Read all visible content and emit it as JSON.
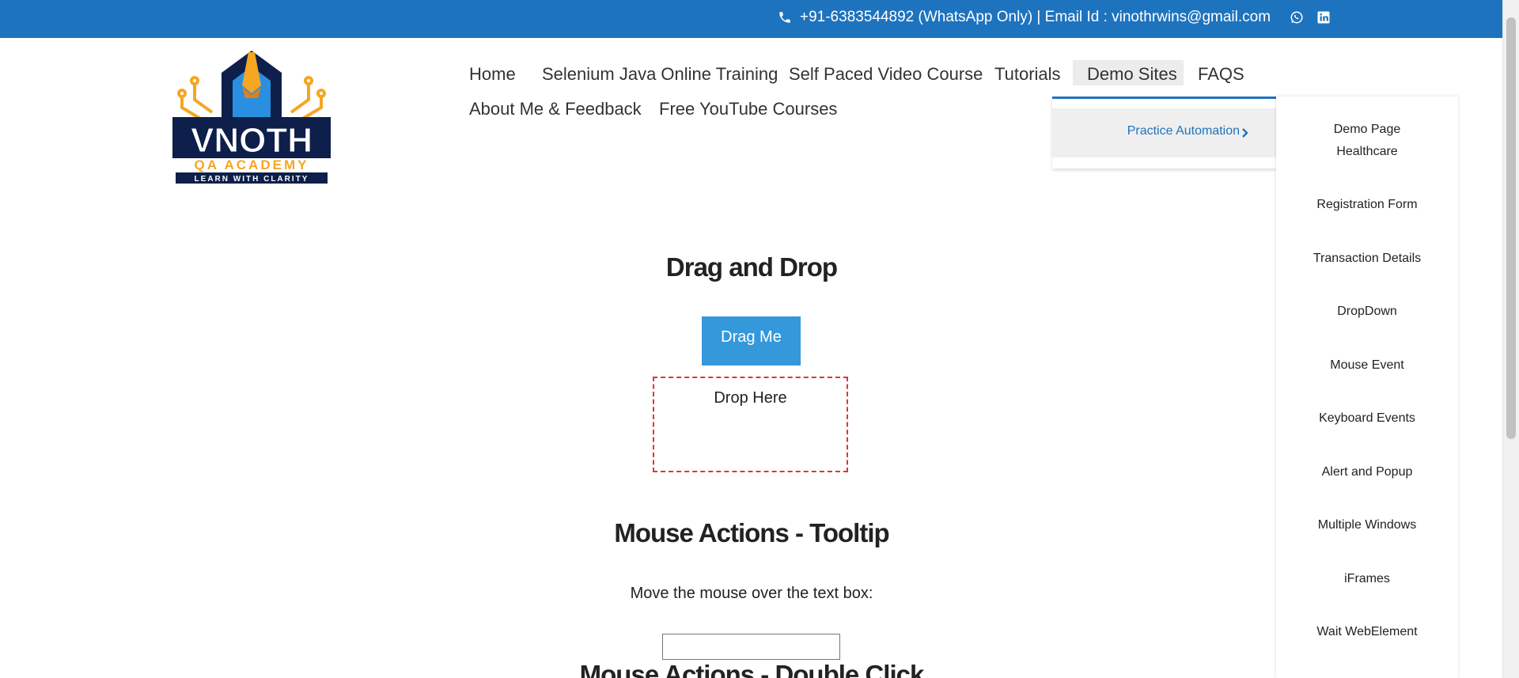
{
  "topbar": {
    "contact_text": "+91-6383544892 (WhatsApp Only) | Email Id : vinothrwins@gmail.com",
    "phone_icon": "phone-icon",
    "social_icons": [
      "whatsapp-icon",
      "linkedin-icon"
    ],
    "bg_color": "#1e73be"
  },
  "logo": {
    "line1": "VNOTH",
    "line2": "QA ACADEMY",
    "line3": "LEARN WITH CLARITY"
  },
  "nav": {
    "items": [
      "Home",
      "Selenium Java Online Training",
      "Self Paced Video Course",
      "Tutorials",
      "Demo Sites",
      "FAQS",
      "About Me & Feedback",
      "Free YouTube Courses"
    ],
    "active": "Demo Sites"
  },
  "dropdown": {
    "item": "Practice Automation",
    "submenu": [
      "Demo Page",
      "Healthcare",
      "Registration Form",
      "Transaction Details",
      "DropDown",
      "Mouse Event",
      "Keyboard Events",
      "Alert and Popup",
      "Multiple Windows",
      "iFrames",
      "Wait WebElement"
    ]
  },
  "main": {
    "drag_title": "Drag and Drop",
    "drag_button": "Drag Me",
    "drop_label": "Drop Here",
    "tooltip_title": "Mouse Actions - Tooltip",
    "tooltip_hint": "Move the mouse over the text box:",
    "tooltip_input_value": "",
    "dblclick_title": "Mouse Actions - Double Click"
  }
}
